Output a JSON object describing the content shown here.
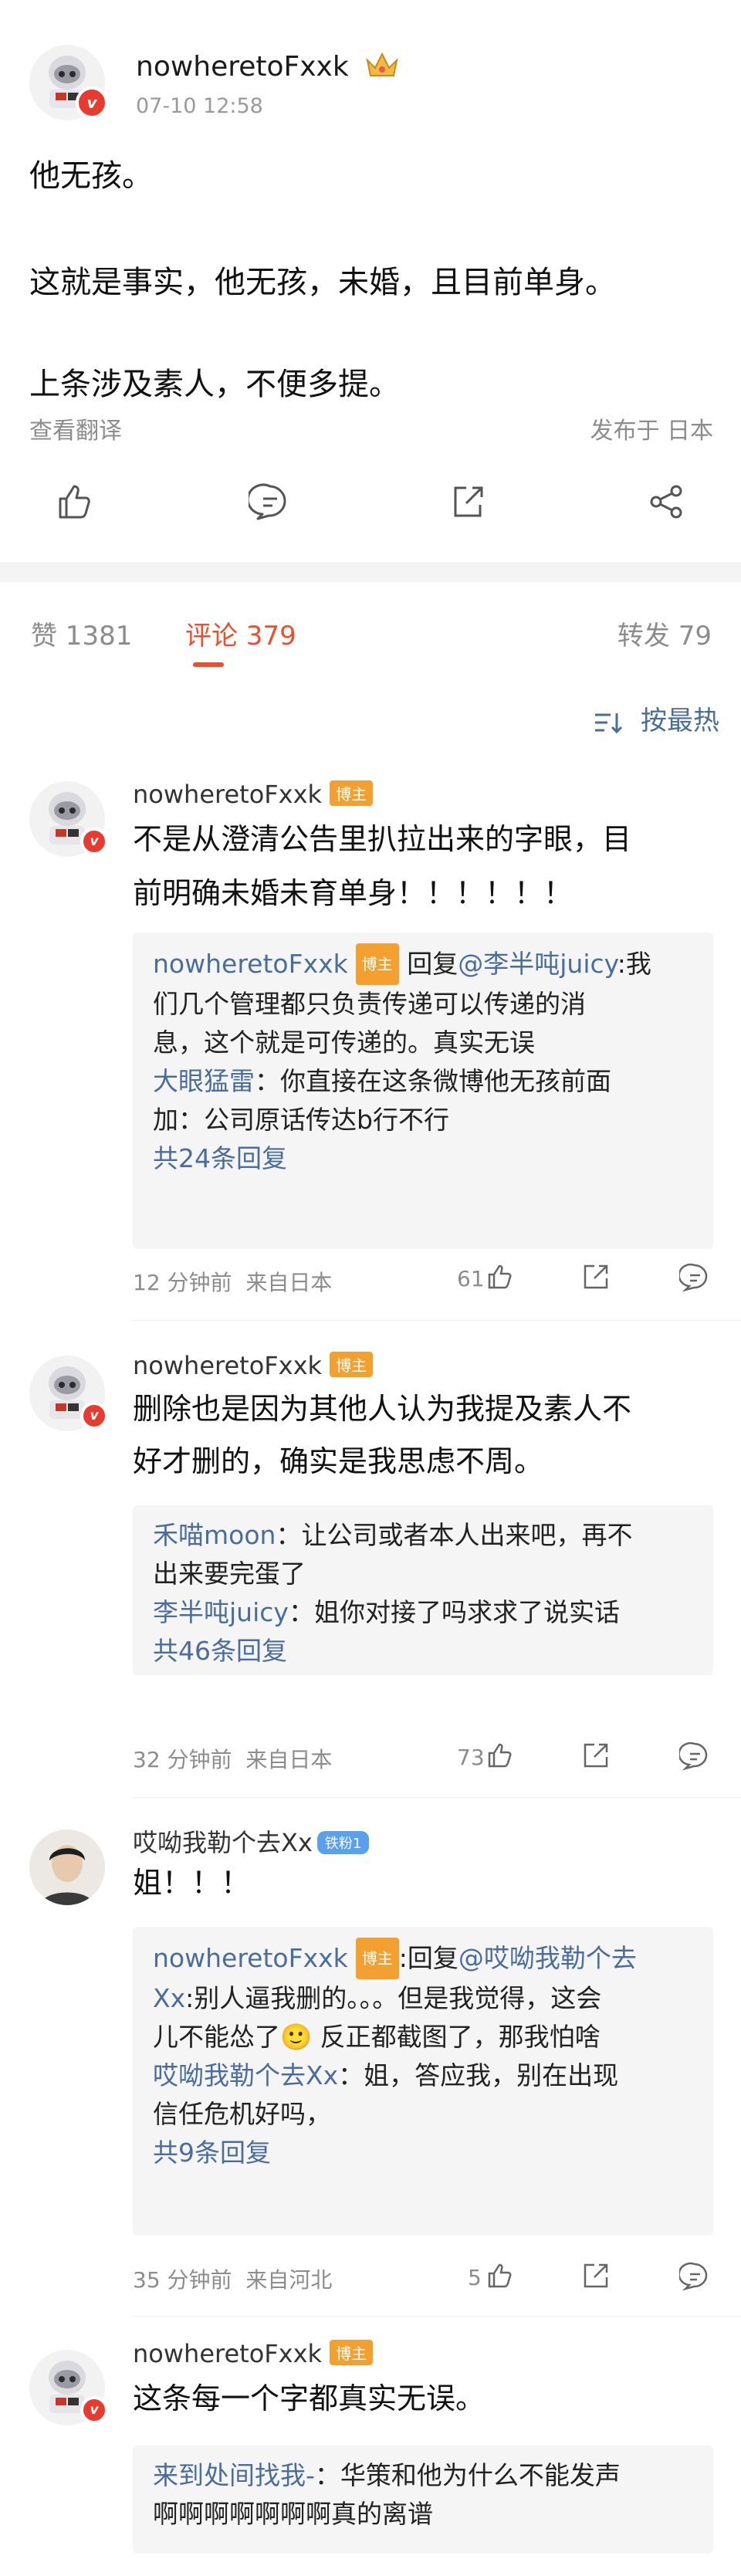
{
  "post": {
    "author": "nowheretoFxxk",
    "time": "07-10 12:58",
    "lines": [
      "他无孩。",
      "这就是事实，他无孩，未婚，且目前单身。",
      "上条涉及素人，不便多提。"
    ],
    "translate": "查看翻译",
    "location": "发布于 日本"
  },
  "stats": {
    "likes": "赞 1381",
    "comments": "评论 379",
    "reposts": "转发 79"
  },
  "sort_label": "按最热",
  "comments": [
    {
      "name": "nowheretoFxxk",
      "tag": "博主",
      "lines": [
        "不是从澄清公告里扒拉出来的字眼，目",
        "前明确未婚未育单身！！！！！！"
      ],
      "replies": [
        {
          "name": "nowheretoFxxk",
          "tag": "博主",
          "reply_to": "回复",
          "mention": "@李半吨juicy",
          "text": ":我"
        },
        {
          "text": "们几个管理都只负责传递可以传递的消"
        },
        {
          "text": "息，这个就是可传递的。真实无误"
        },
        {
          "name": "大眼猛雷",
          "text": "：你直接在这条微博他无孩前面"
        },
        {
          "text": "加：公司原话传达b行不行"
        }
      ],
      "reply_count": "共24条回复",
      "time": "12 分钟前",
      "source": "来自日本",
      "likes": "61"
    },
    {
      "name": "nowheretoFxxk",
      "tag": "博主",
      "lines": [
        "删除也是因为其他人认为我提及素人不",
        "好才删的，确实是我思虑不周。"
      ],
      "replies": [
        {
          "name": "禾喵moon",
          "text": "：让公司或者本人出来吧，再不"
        },
        {
          "text": "出来要完蛋了"
        },
        {
          "name": "李半吨juicy",
          "text": "：姐你对接了吗求求了说实话"
        }
      ],
      "reply_count": "共46条回复",
      "time": "32 分钟前",
      "source": "来自日本",
      "likes": "73"
    },
    {
      "name": "哎呦我勒个去Xx",
      "fan": "铁粉1",
      "lines": [
        "姐！！！"
      ],
      "replies": [
        {
          "name": "nowheretoFxxk",
          "tag": "博主",
          "reply_to": ":回复",
          "mention": "@哎呦我勒个去",
          "text": ""
        },
        {
          "name": "Xx",
          "text": ":别人逼我删的。。。但是我觉得，这会"
        },
        {
          "text": "儿不能怂了🙂 反正都截图了，那我怕啥"
        },
        {
          "name": "哎呦我勒个去Xx",
          "text": "：姐，答应我，别在出现"
        },
        {
          "text": "信任危机好吗，"
        }
      ],
      "reply_count": "共9条回复",
      "time": "35 分钟前",
      "source": "来自河北",
      "likes": "5"
    },
    {
      "name": "nowheretoFxxk",
      "tag": "博主",
      "lines": [
        "这条每一个字都真实无误。"
      ],
      "replies": [
        {
          "name": "来到处间找我-",
          "text": "：华策和他为什么不能发声"
        },
        {
          "text": "啊啊啊啊啊啊啊真的离谱"
        }
      ]
    }
  ],
  "colors": {
    "accent": "#e8502f",
    "link": "#4a6d9c",
    "tag": "#f4a030",
    "verified": "#e63b2e"
  }
}
